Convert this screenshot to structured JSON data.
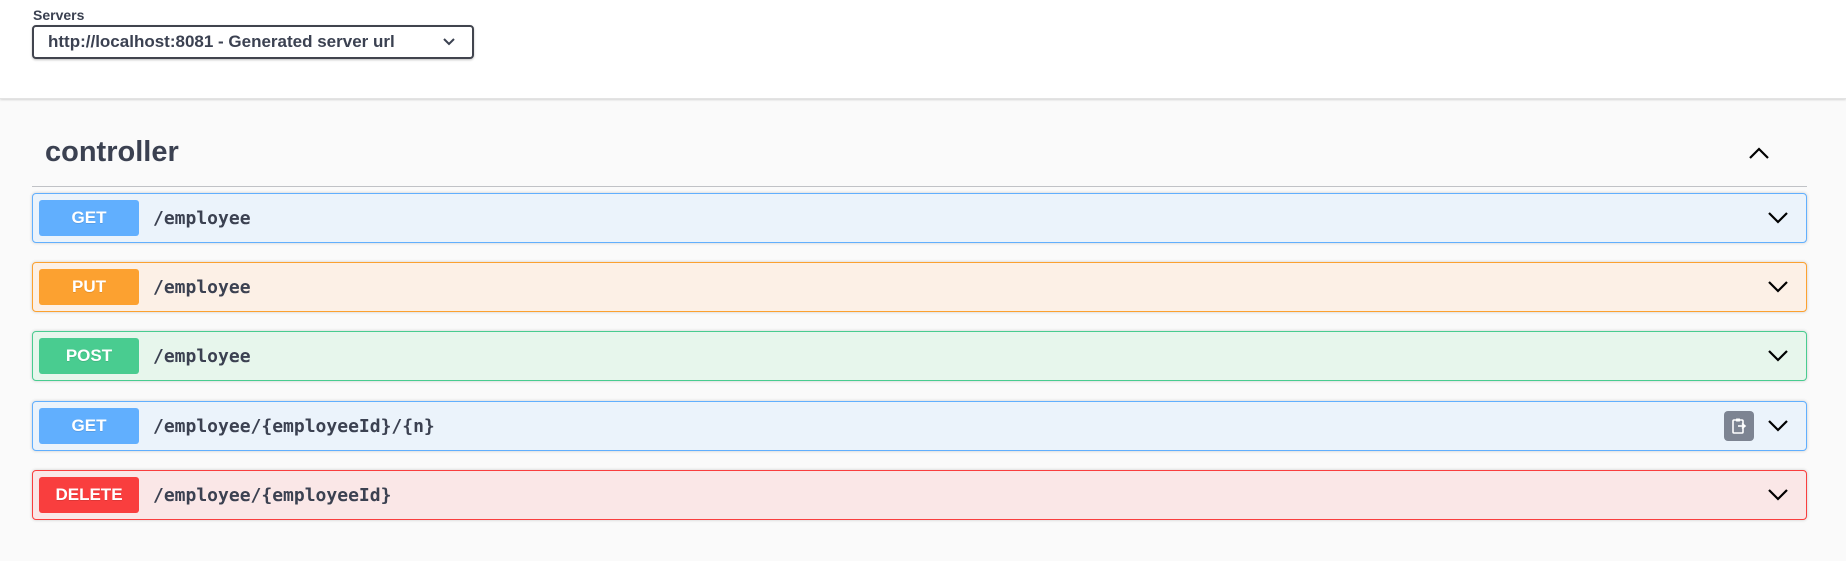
{
  "servers": {
    "label": "Servers",
    "selected": "http://localhost:8081 - Generated server url"
  },
  "tag": {
    "name": "controller"
  },
  "operations": [
    {
      "method": "GET",
      "path": "/employee",
      "color": "#61affe",
      "bg": "#ebf3fb"
    },
    {
      "method": "PUT",
      "path": "/employee",
      "color": "#fca130",
      "bg": "#fcf0e6"
    },
    {
      "method": "POST",
      "path": "/employee",
      "color": "#49cc90",
      "bg": "#e7f6ec"
    },
    {
      "method": "GET",
      "path": "/employee/{employeeId}/{n}",
      "color": "#61affe",
      "bg": "#ebf3fb"
    },
    {
      "method": "DELETE",
      "path": "/employee/{employeeId}",
      "color": "#f93e3e",
      "bg": "#fae7e7"
    }
  ],
  "icons": {
    "server_dropdown": "chevron-down-icon",
    "tag_toggle": "chevron-up-icon",
    "operation_expand": "chevron-down-icon",
    "copy": "copy-to-clipboard-icon"
  }
}
